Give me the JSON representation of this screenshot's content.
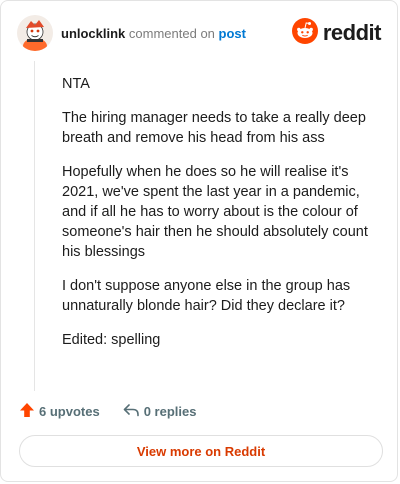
{
  "header": {
    "username": "unlocklink",
    "action_text": "commented on",
    "post_link": "post",
    "logo_text": "reddit"
  },
  "comment": {
    "paragraphs": [
      "NTA",
      "The hiring manager needs to take a really deep breath and remove his head from his ass",
      "Hopefully when he does so he will realise it's 2021, we've spent the last year in a pandemic, and if all he has to worry about is the colour of someone's hair then he should absolutely count his blessings",
      "I don't suppose anyone else in the group has unnaturally blonde hair? Did they declare it?",
      "Edited: spelling"
    ]
  },
  "footer": {
    "upvotes": "6 upvotes",
    "replies": "0 replies"
  },
  "cta": {
    "label": "View more on Reddit"
  },
  "colors": {
    "brand": "#ff4500",
    "link": "#0079d3",
    "cta_text": "#d93a00"
  },
  "icons": {
    "avatar": "avatar-icon",
    "logo": "reddit-logo-icon",
    "upvote": "upvote-arrow-icon",
    "reply": "reply-arrow-icon"
  }
}
